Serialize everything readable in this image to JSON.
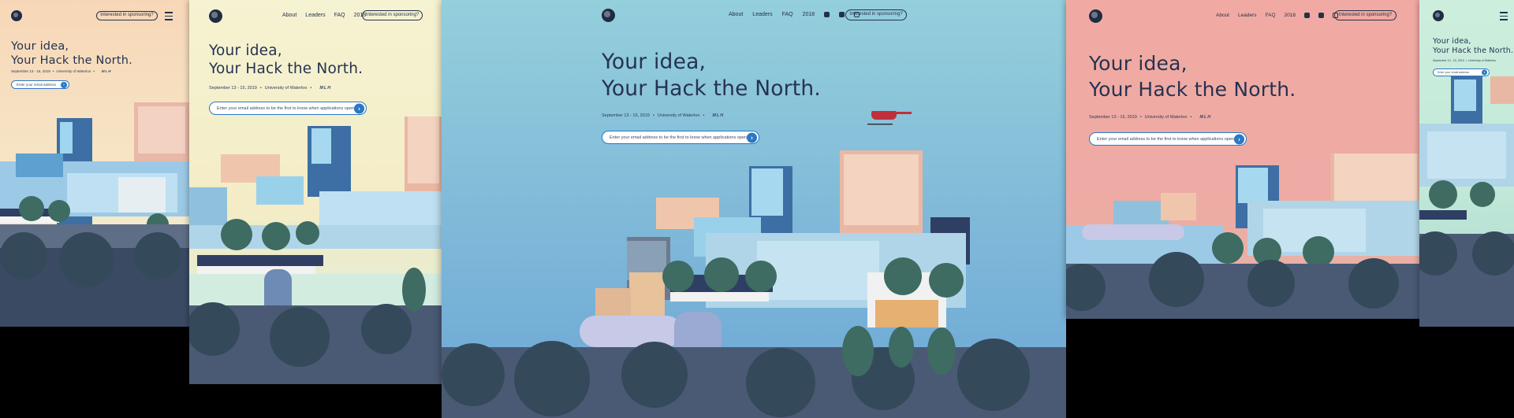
{
  "brand": {
    "logo": "globe-logo"
  },
  "nav": {
    "links": [
      "About",
      "Leaders",
      "FAQ",
      "2018"
    ],
    "sponsor_button": "Interested in sponsoring?"
  },
  "hero": {
    "line1": "Your idea,",
    "line2": "Your Hack the North.",
    "date": "September 13 - 15, 2019",
    "venue": "University of Waterloo",
    "separator": "•",
    "partner": "MLH"
  },
  "signup": {
    "short_placeholder": "Enter your email address",
    "placeholder": "Enter your email address to be the first to know when applications open",
    "submit_icon": "arrow-right-icon"
  },
  "colors": {
    "peach_sky": "#f6dcc0",
    "cream_sky": "#f6f1cf",
    "blue_sky": "#8ecbdc",
    "pink_sky": "#efaaa4",
    "mint_sky": "#c4ead8",
    "accent": "#2b78c4",
    "ink": "#253350"
  }
}
